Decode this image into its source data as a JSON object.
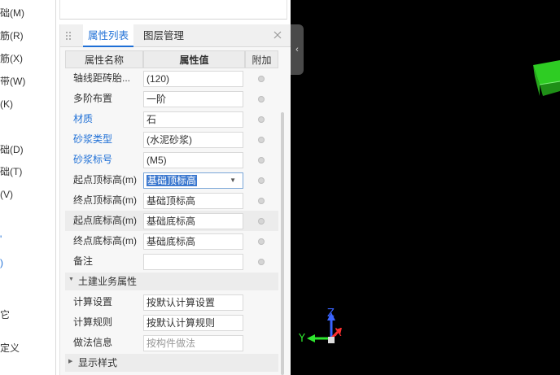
{
  "left_nav": {
    "items": [
      "础(M)",
      "筋(R)",
      "筋(X)",
      "带(W)",
      "(K)",
      "础(D)",
      "础(T)",
      "(V)",
      "它",
      "定义"
    ]
  },
  "prop_panel": {
    "tabs": [
      "属性列表",
      "图层管理"
    ],
    "active_tab": "属性列表",
    "columns": [
      "属性名称",
      "属性值",
      "附加"
    ],
    "rows": [
      {
        "name": "轴线距砖胎...",
        "value": "(120)"
      },
      {
        "name": "多阶布置",
        "value": "一阶"
      },
      {
        "name": "材质",
        "value": "石"
      },
      {
        "name": "砂浆类型",
        "value": "(水泥砂浆)"
      },
      {
        "name": "砂浆标号",
        "value": "(M5)"
      },
      {
        "name": "起点顶标高(m)",
        "value": "基础顶标高"
      },
      {
        "name": "终点顶标高(m)",
        "value": "基础顶标高"
      },
      {
        "name": "起点底标高(m)",
        "value": "基础底标高"
      },
      {
        "name": "终点底标高(m)",
        "value": "基础底标高"
      },
      {
        "name": "备注",
        "value": ""
      }
    ],
    "section_civil": "土建业务属性",
    "civil_rows": [
      {
        "name": "计算设置",
        "value": "按默认计算设置"
      },
      {
        "name": "计算规则",
        "value": "按默认计算规则"
      },
      {
        "name": "做法信息",
        "value": "按构件做法"
      }
    ],
    "section_display": "显示样式"
  },
  "viewport": {
    "axis_x": "X",
    "axis_y": "Y",
    "axis_z": "Z"
  },
  "colors": {
    "accent": "#1e6fd6",
    "viewport_bg": "#000000",
    "green_object": "#2ecc23",
    "axis_x": "#ff3030",
    "axis_y": "#2ee62e",
    "axis_z": "#3a64ff"
  },
  "icons": {
    "drag": "drag-handle-icon",
    "close": "close-icon",
    "collapse": "chevron-left-icon",
    "expand": "caret-down-icon",
    "collapsed": "caret-right-icon"
  }
}
